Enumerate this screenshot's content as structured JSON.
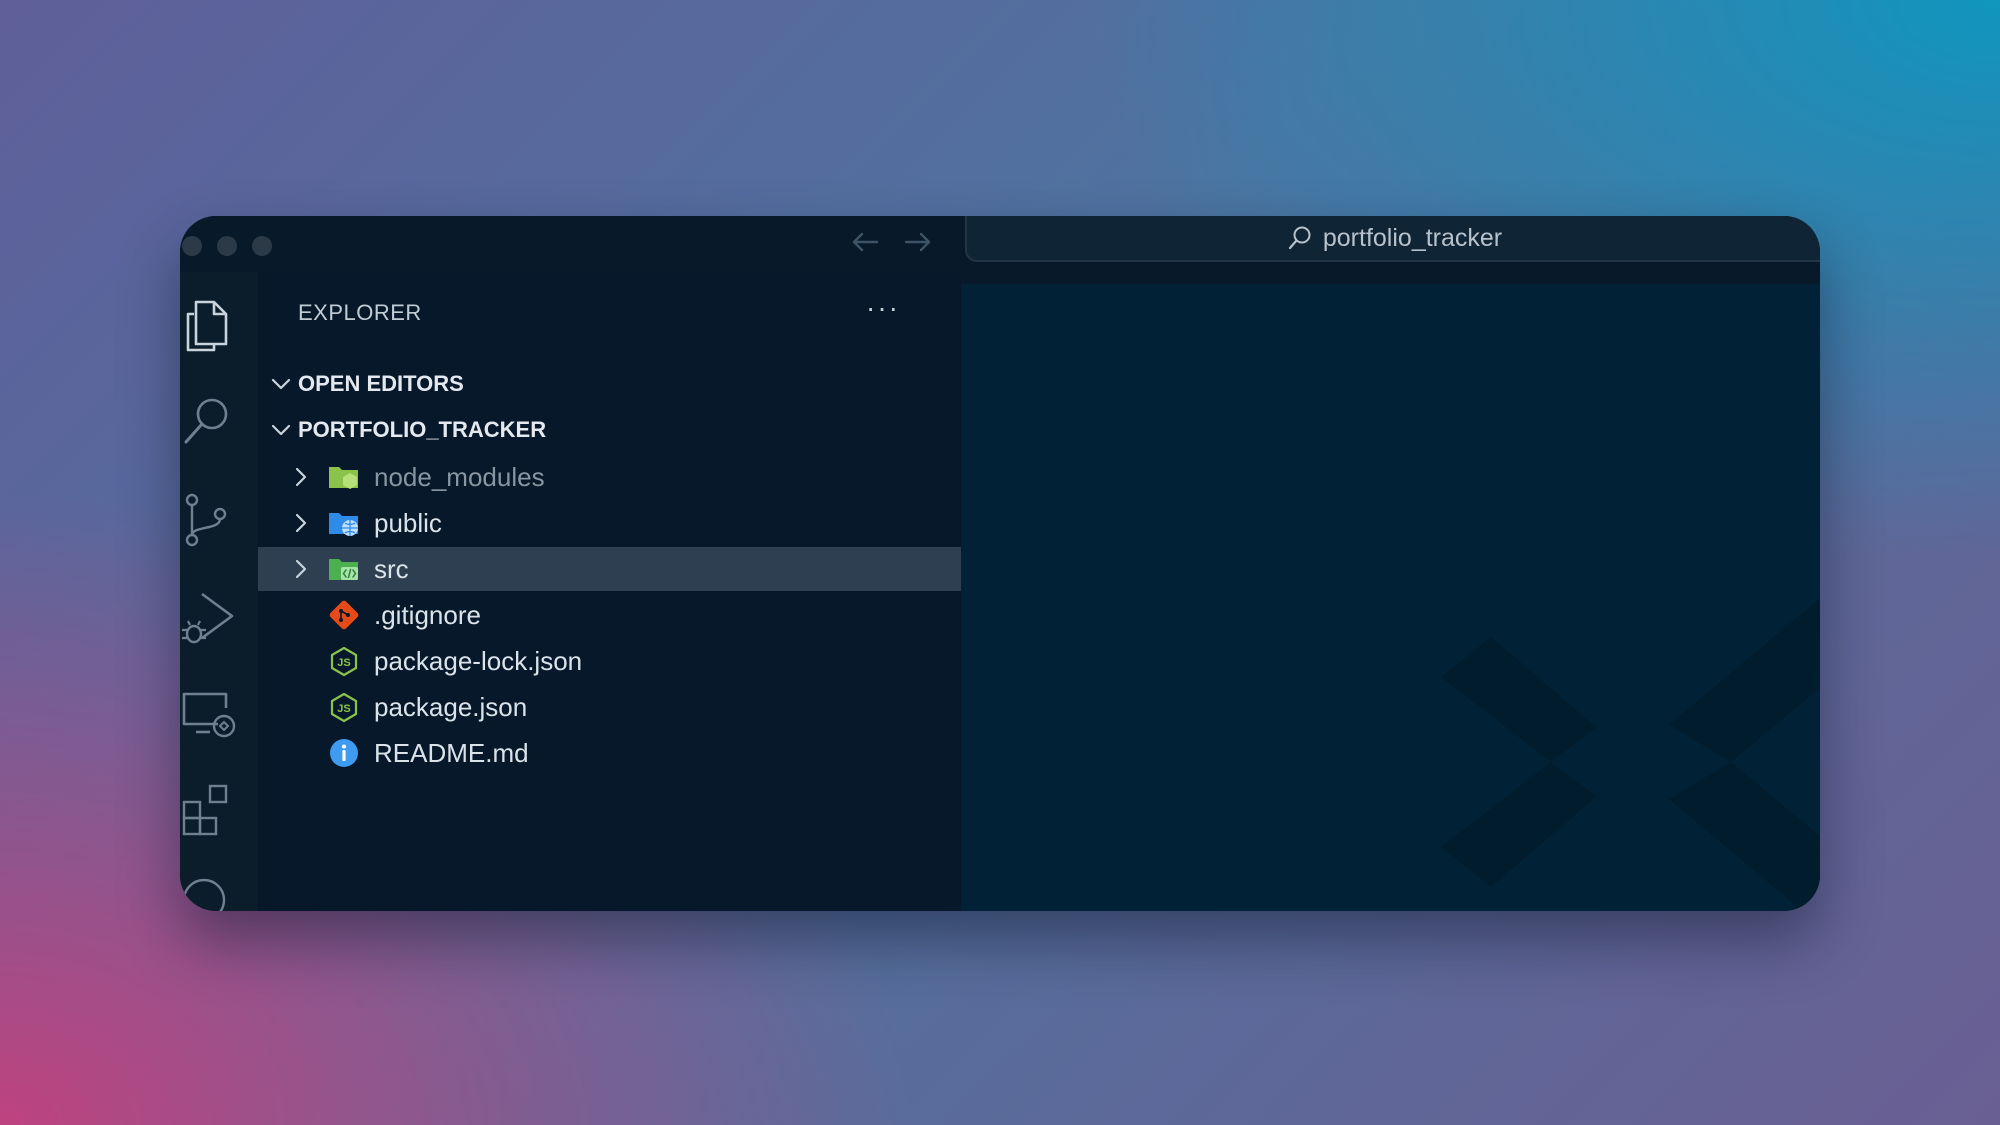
{
  "window": {
    "search_text": "portfolio_tracker"
  },
  "icons": {
    "nav_back": "arrow-left-icon",
    "nav_forward": "arrow-right-icon",
    "search": "search-icon",
    "activity": [
      "files-icon",
      "search-icon",
      "source-control-icon",
      "run-debug-icon",
      "remote-explorer-icon",
      "extensions-icon",
      "accounts-icon"
    ]
  },
  "sidebar": {
    "title": "EXPLORER",
    "more": "···",
    "sections": [
      {
        "label": "OPEN EDITORS"
      },
      {
        "label": "PORTFOLIO_TRACKER"
      }
    ],
    "items": [
      {
        "name": "node_modules",
        "type": "folder",
        "icon": "node-folder-icon"
      },
      {
        "name": "public",
        "type": "folder",
        "icon": "public-folder-icon"
      },
      {
        "name": "src",
        "type": "folder",
        "icon": "src-folder-icon",
        "selected": true
      },
      {
        "name": ".gitignore",
        "type": "file",
        "icon": "git-icon"
      },
      {
        "name": "package-lock.json",
        "type": "file",
        "icon": "nodejs-icon"
      },
      {
        "name": "package.json",
        "type": "file",
        "icon": "nodejs-icon"
      },
      {
        "name": "README.md",
        "type": "file",
        "icon": "info-icon"
      }
    ]
  },
  "colors": {
    "accent_green": "#8bc34a",
    "folder_blue": "#2f8be8",
    "git_orange": "#e64a19",
    "info_blue": "#3f9bf0",
    "selection": "#2d3f50"
  }
}
